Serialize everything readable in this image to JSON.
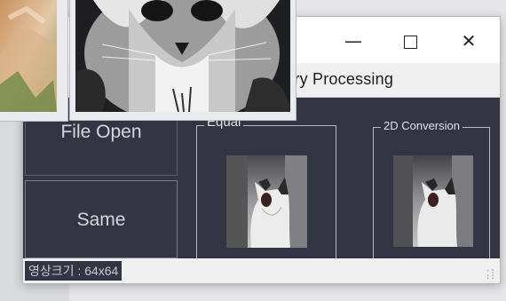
{
  "window": {
    "controls": {
      "minimize": "—",
      "maximize": "",
      "close": "✕"
    },
    "menu_item": "etry Processing"
  },
  "buttons": {
    "file_open": "File Open",
    "same": "Same"
  },
  "groups": {
    "equal_title": "Equal",
    "conversion_title": "2D Conversion"
  },
  "status": {
    "text": "영상크기 : 64x64"
  },
  "colors": {
    "panel_bg": "#343544",
    "titlebar_bg": "#ffffff",
    "menubar_bg": "#f0f0f0"
  }
}
